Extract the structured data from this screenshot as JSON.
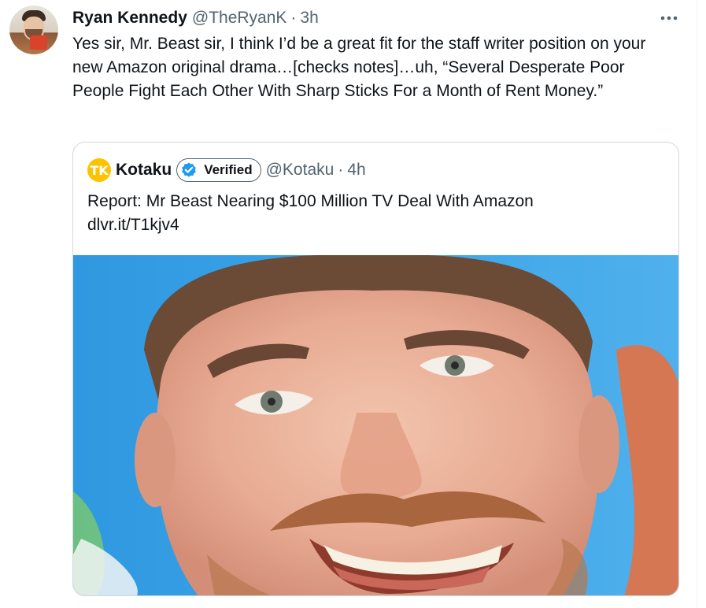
{
  "tweet": {
    "author_name": "Ryan Kennedy",
    "author_handle": "@TheRyanK",
    "separator": "·",
    "timestamp": "3h",
    "more_icon": "more-horizontal-icon",
    "text": "Yes sir, Mr. Beast sir, I think I’d be a great fit for the staff writer position on your new Amazon original drama…[checks notes]…uh, “Several Desperate Poor People Fight Each Other With Sharp Sticks For a Month of Rent Money.”"
  },
  "quote": {
    "logo_text": "TK",
    "author_name": "Kotaku",
    "verified_label": "Verified",
    "author_handle": "@Kotaku",
    "separator": "·",
    "timestamp": "4h",
    "text_line1": "Report: Mr Beast Nearing $100 Million TV Deal With Amazon",
    "text_line2": "dlvr.it/T1kjv4"
  },
  "colors": {
    "text_primary": "#0f1419",
    "text_secondary": "#536471",
    "border": "#cfd9de",
    "verified_blue": "#1d9bf0",
    "kotaku_yellow": "#fdc300"
  }
}
